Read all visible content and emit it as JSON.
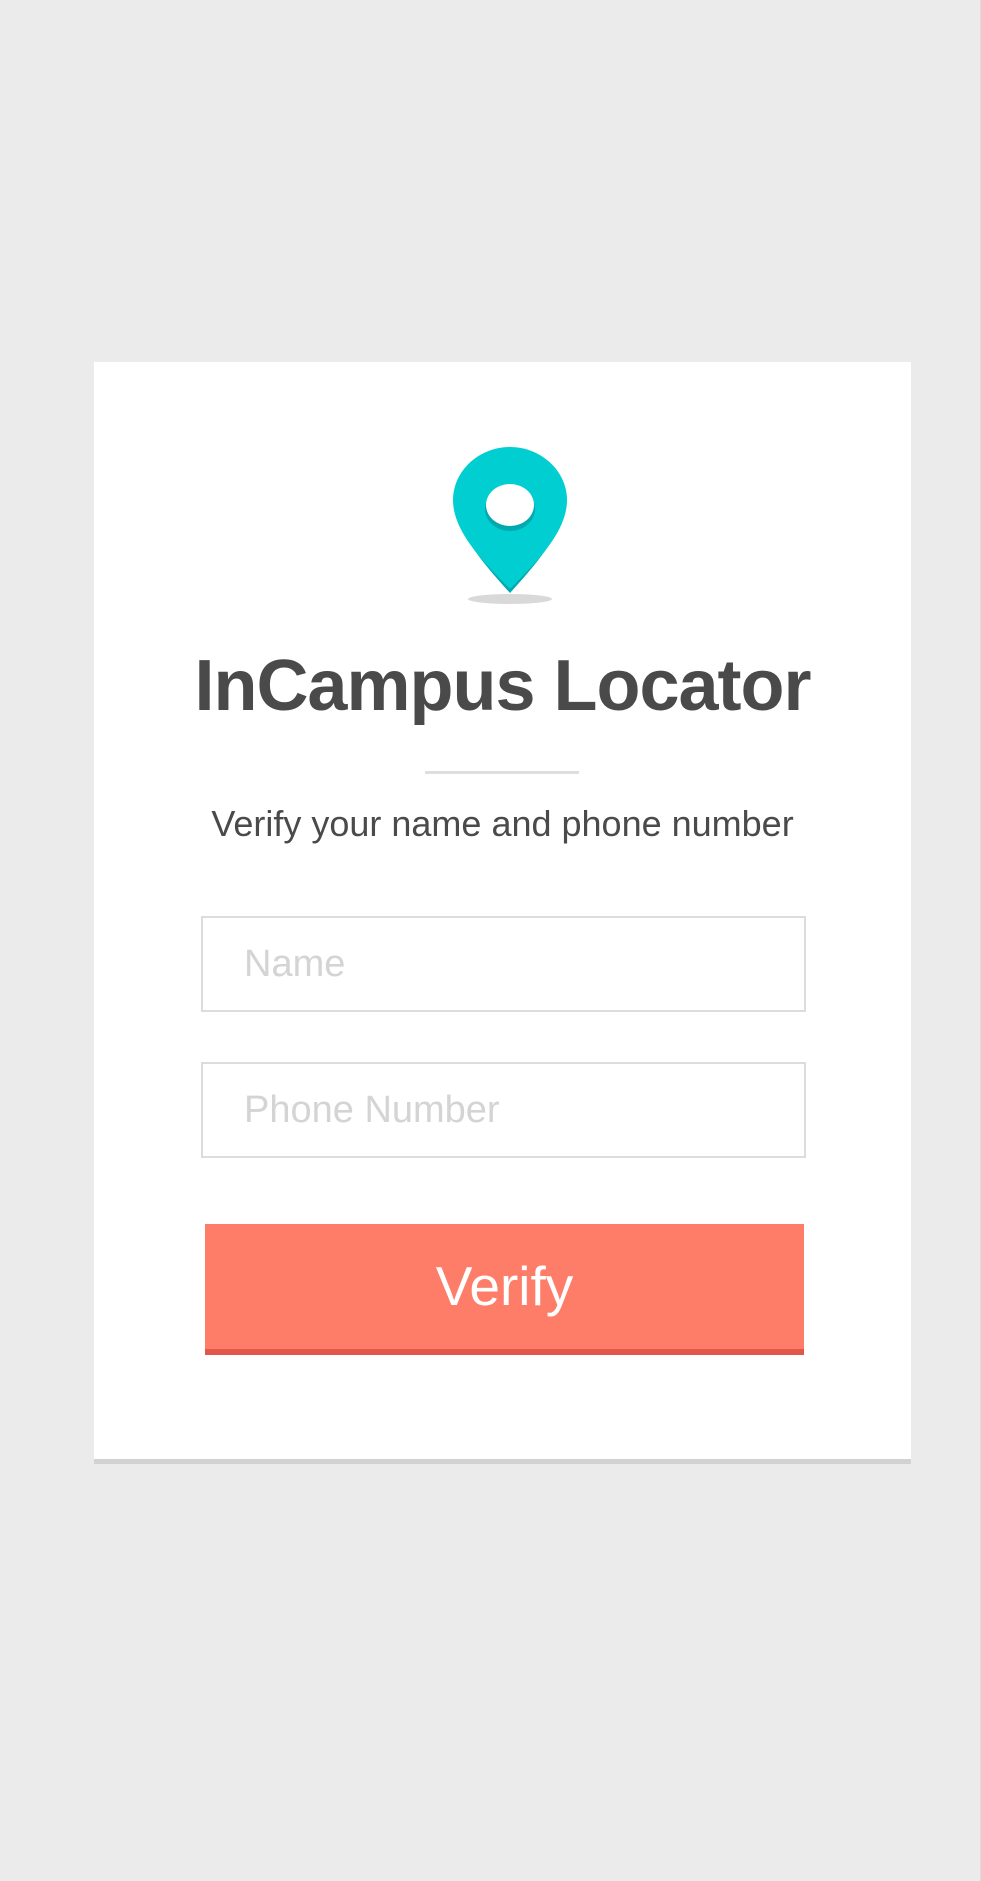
{
  "app": {
    "title": "InCampus Locator",
    "subtitle": "Verify your name and phone number"
  },
  "form": {
    "name_placeholder": "Name",
    "phone_placeholder": "Phone Number",
    "verify_label": "Verify"
  },
  "icons": {
    "logo": "map-pin-icon"
  },
  "colors": {
    "background": "#ebebeb",
    "card": "#ffffff",
    "accent_pin": "#00ced1",
    "button": "#fe7d69",
    "button_shadow": "#e2574a",
    "text": "#4a4a4a",
    "placeholder": "#d4d4d4"
  }
}
